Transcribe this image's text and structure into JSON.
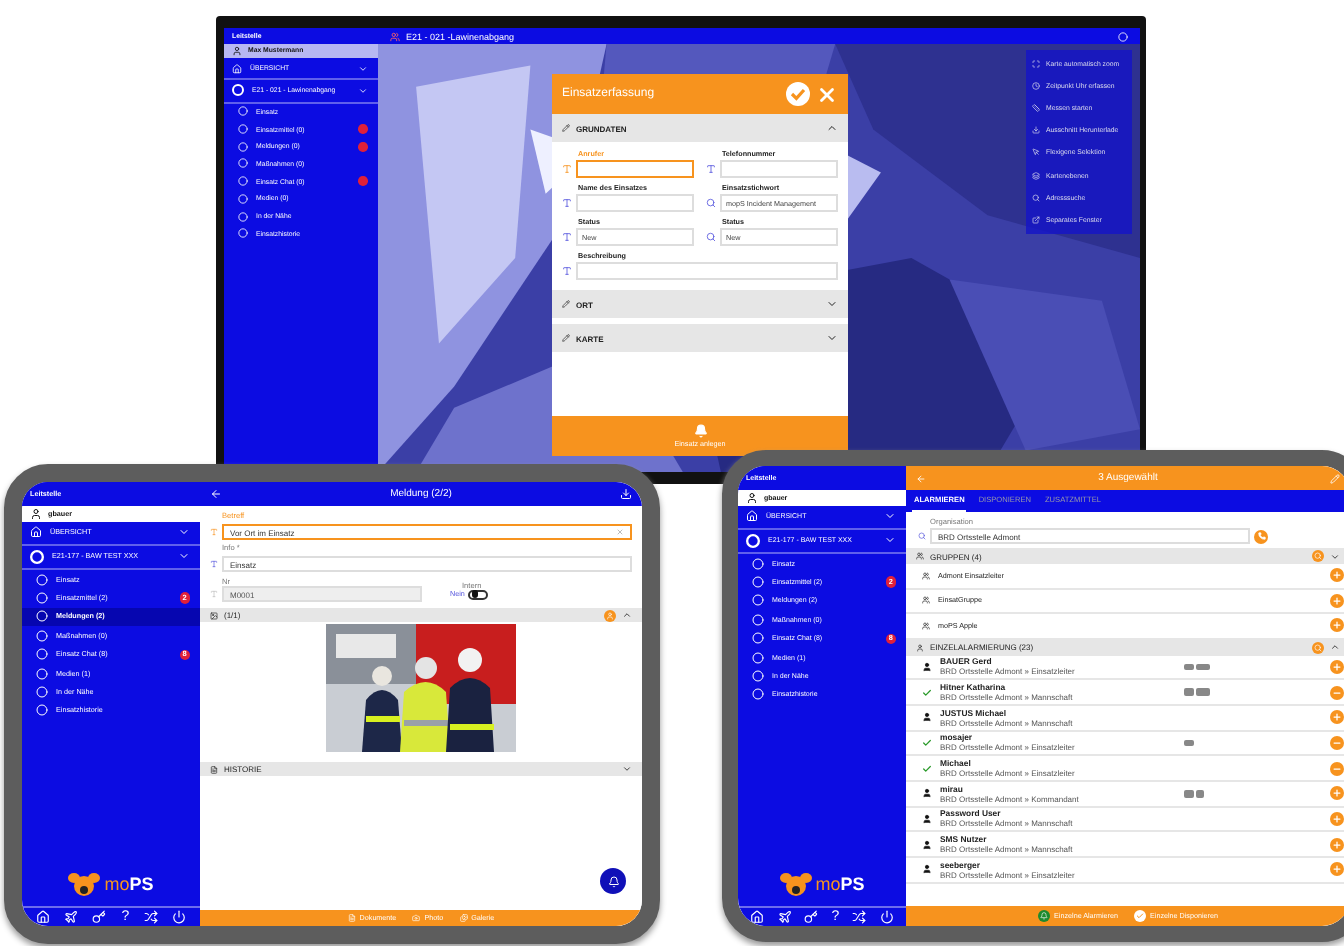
{
  "monitor": {
    "title": "E21 - 021 -Lawinenabgang",
    "sidebar": {
      "title": "Leitstelle",
      "user": "Max Mustermann",
      "groups": [
        "ÜBERSICHT",
        "E21 - 021 - Lawinenabgang"
      ],
      "items": [
        {
          "label": "Einsatz",
          "selected": false,
          "alert": false
        },
        {
          "label": "Einsatzmittel (0)",
          "selected": false,
          "alert": true
        },
        {
          "label": "Meldungen (0)",
          "selected": false,
          "alert": true
        },
        {
          "label": "Maßnahmen (0)",
          "selected": false,
          "alert": false
        },
        {
          "label": "Einsatz Chat (0)",
          "selected": false,
          "alert": true
        },
        {
          "label": "Medien (0)",
          "selected": false,
          "alert": false
        },
        {
          "label": "In der Nähe",
          "selected": false,
          "alert": false
        },
        {
          "label": "Einsatzhistorie",
          "selected": false,
          "alert": false
        }
      ]
    },
    "dialog": {
      "title": "Einsatzerfassung",
      "sections": [
        {
          "title": "GRUNDATEN",
          "expanded": true,
          "fields": [
            {
              "label": "Anrufer",
              "kind": "text",
              "focused": true,
              "wide": false
            },
            {
              "label": "Telefonnummer",
              "kind": "text",
              "focused": false,
              "wide": false
            },
            {
              "label": "Name des Einsatzes",
              "kind": "text",
              "focused": false,
              "wide": false
            },
            {
              "label": "Einsatzstichwort",
              "kind": "search",
              "value": "mopS Incident Management",
              "focused": false,
              "wide": false
            },
            {
              "label": "Status",
              "kind": "text",
              "value": "New",
              "focused": false,
              "wide": false
            },
            {
              "label": "Status",
              "kind": "search",
              "value": "New",
              "focused": false,
              "wide": false
            },
            {
              "label": "Beschreibung",
              "kind": "text",
              "focused": false,
              "wide": true
            }
          ]
        },
        {
          "title": "ORT",
          "expanded": false
        },
        {
          "title": "KARTE",
          "expanded": false
        }
      ],
      "action": "Einsatz anlegen"
    },
    "map_menu": [
      "Karte automatisch zoom",
      "Zeitpunkt Uhr erfassen",
      "Messen starten",
      "Ausschnitt Herunterlade",
      "Flexigene Selektion",
      "Kartenebenen",
      "Adresssuche",
      "Separates Fenster"
    ]
  },
  "left_tablet": {
    "title": "Meldung (2/2)",
    "sidebar": {
      "title": "Leitstelle",
      "user": "gbauer",
      "groups": [
        "ÜBERSICHT",
        "E21-177 - BAW TEST XXX"
      ],
      "items": [
        {
          "label": "Einsatz",
          "selected": false
        },
        {
          "label": "Einsatzmittel (2)",
          "selected": false,
          "badge": "2"
        },
        {
          "label": "Meldungen (2)",
          "selected": true
        },
        {
          "label": "Maßnahmen (0)",
          "selected": false
        },
        {
          "label": "Einsatz Chat (8)",
          "selected": false,
          "badge": "8"
        },
        {
          "label": "Medien (1)",
          "selected": false
        },
        {
          "label": "In der Nähe",
          "selected": false
        },
        {
          "label": "Einsatzhistorie",
          "selected": false
        }
      ],
      "logo": "mo**PS**",
      "help": "?"
    },
    "fields": [
      {
        "label": "Betreff",
        "value": "Vor Ort im Einsatz",
        "focused": true,
        "disabled": false
      },
      {
        "label": "Info *",
        "value": "Einsatz",
        "focused": false,
        "disabled": false
      }
    ],
    "number": {
      "label": "Nr",
      "value": "M0001",
      "disabled": true
    },
    "intern": {
      "label": "Intern",
      "value": "Nein",
      "on": false
    },
    "attachments": {
      "title": "(1/1)",
      "expanded": true
    },
    "history": {
      "title": "HISTORIE",
      "expanded": false
    },
    "actions": [
      "Dokumente",
      "Photo",
      "Galerie"
    ]
  },
  "right_tablet": {
    "title": "3 Ausgewählt",
    "sidebar": {
      "title": "Leitstelle",
      "user": "gbauer",
      "groups": [
        "ÜBERSICHT",
        "E21-177 - BAW TEST XXX"
      ],
      "items": [
        {
          "label": "Einsatz",
          "selected": false
        },
        {
          "label": "Einsatzmittel (2)",
          "selected": false,
          "badge": "2"
        },
        {
          "label": "Meldungen (2)",
          "selected": false
        },
        {
          "label": "Maßnahmen (0)",
          "selected": false
        },
        {
          "label": "Einsatz Chat (8)",
          "selected": false,
          "badge": "8"
        },
        {
          "label": "Medien (1)",
          "selected": false
        },
        {
          "label": "In der Nähe",
          "selected": false
        },
        {
          "label": "Einsatzhistorie",
          "selected": false
        }
      ],
      "logo": "mo**PS**",
      "help": "?"
    },
    "tabs": [
      {
        "label": "ALARMIEREN",
        "selected": true
      },
      {
        "label": "DISPONIEREN",
        "selected": false
      },
      {
        "label": "ZUSATZMITTEL",
        "selected": false
      }
    ],
    "organisation": {
      "label": "Organisation",
      "value": "BRD Ortsstelle Admont"
    },
    "groups": {
      "title": "GRUPPEN (4)",
      "expanded": false,
      "items": [
        "Admont Einsatzleiter",
        "EinsatGruppe",
        "moPS Apple"
      ]
    },
    "people": {
      "title": "EINZELALARMIERUNG (23)",
      "expanded": true,
      "items": [
        {
          "name": "BAUER Gerd",
          "role": "BRD Ortsstelle Admont » Einsatzleiter",
          "selected": false,
          "tags": [
            {
              "kind": "short"
            },
            {
              "kind": "long"
            }
          ]
        },
        {
          "name": "Hitner Katharina",
          "role": "BRD Ortsstelle Admont » Mannschaft",
          "selected": true,
          "tags": [
            {
              "kind": "short"
            },
            {
              "kind": "long"
            }
          ]
        },
        {
          "name": "JUSTUS Michael",
          "role": "BRD Ortsstelle Admont » Mannschaft",
          "selected": false
        },
        {
          "name": "mosajer",
          "role": "BRD Ortsstelle Admont » Einsatzleiter",
          "selected": true,
          "tags": [
            {
              "kind": "short"
            }
          ]
        },
        {
          "name": "Michael",
          "role": "BRD Ortsstelle Admont » Einsatzleiter",
          "selected": true
        },
        {
          "name": "mirau",
          "role": "BRD Ortsstelle Admont » Kommandant",
          "selected": false,
          "tags": [
            {
              "kind": "short"
            },
            {
              "kind": "short"
            }
          ]
        },
        {
          "name": "Password User",
          "role": "BRD Ortsstelle Admont » Mannschaft",
          "selected": false
        },
        {
          "name": "SMS Nutzer",
          "role": "BRD Ortsstelle Admont » Mannschaft",
          "selected": false
        },
        {
          "name": "seeberger",
          "role": "BRD Ortsstelle Admont » Einsatzleiter",
          "selected": false
        }
      ]
    },
    "actions": [
      {
        "label": "Einzelne Alarmieren",
        "kind": "alarm"
      },
      {
        "label": "Einzelne Disponieren",
        "kind": "dispatch"
      }
    ]
  }
}
